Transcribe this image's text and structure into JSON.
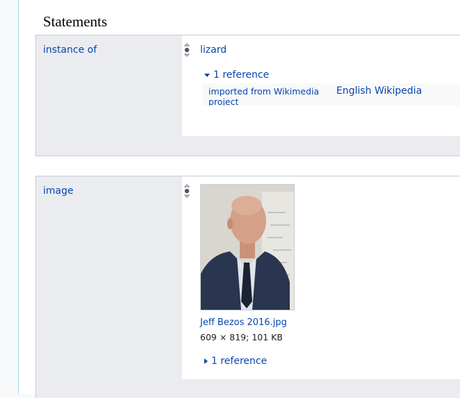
{
  "page": {
    "section_title": "Statements"
  },
  "statements": [
    {
      "property": "instance of",
      "value": "lizard",
      "references_label": "1 reference",
      "reference": {
        "property": "imported from Wikimedia project",
        "value": "English Wikipedia"
      }
    },
    {
      "property": "image",
      "file_name": "Jeff Bezos 2016.jpg",
      "file_meta": "609 × 819; 101 KB",
      "references_label": "1 reference",
      "thumbnail_icon": "portrait-photo"
    }
  ],
  "colors": {
    "link": "#0645ad",
    "group_bg": "#eaecf0",
    "border": "#c8ccd1"
  }
}
